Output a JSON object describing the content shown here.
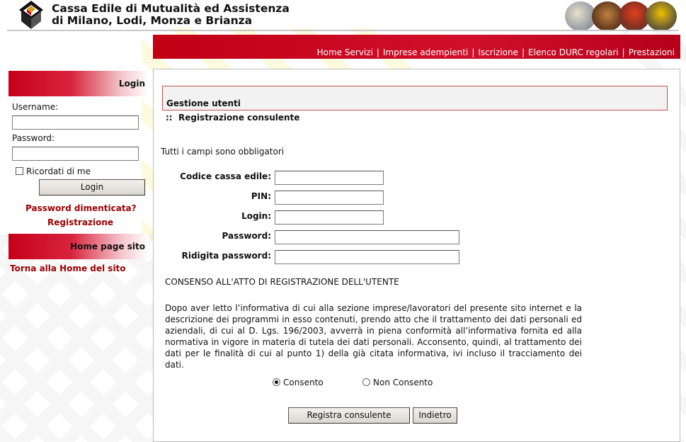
{
  "header": {
    "org_line1": "Cassa Edile di Mutualità ed Assistenza",
    "org_line2": "di Milano, Lodi, Monza e Brianza"
  },
  "nav": {
    "items": [
      "Home Servizi",
      "Imprese adempienti",
      "Iscrizione",
      "Elenco DURC regolari",
      "Prestazioni"
    ],
    "separator": "|"
  },
  "login_box": {
    "title": "Login",
    "username_label": "Username:",
    "username_value": "",
    "password_label": "Password:",
    "password_value": "",
    "remember_label": "Ricordati di me",
    "remember_checked": false,
    "login_button": "Login",
    "forgot_link": "Password dimenticata?",
    "register_link": "Registrazione"
  },
  "home_box": {
    "title": "Home page sito",
    "back_link": "Torna alla Home del sito"
  },
  "main": {
    "section_title": "Gestione utenti",
    "subtitle_prefix": "::",
    "subtitle": "Registrazione consulente",
    "required_note": "Tutti i campi sono obbligatori",
    "fields": [
      {
        "label": "Codice cassa edile:",
        "value": ""
      },
      {
        "label": "PIN:",
        "value": ""
      },
      {
        "label": "Login:",
        "value": ""
      },
      {
        "label": "Password:",
        "value": ""
      },
      {
        "label": "Ridigita password:",
        "value": ""
      }
    ],
    "consent_heading": "CONSENSO ALL'ATTO DI REGISTRAZIONE DELL'UTENTE",
    "consent_text": "Dopo aver letto l’informativa di cui alla sezione imprese/lavoratori del presente sito internet e la descrizione dei programmi in esso contenuti, prendo atto che il trattamento dei dati personali ed aziendali, di cui al D. Lgs. 196/2003, avverrà in piena conformità all’informativa fornita ed alla normativa in vigore in materia di tutela dei dati personali. Acconsento, quindi, al trattamento dei dati per le finalità di cui al punto 1) della già citata informativa, ivi incluso il tracciamento dei dati.",
    "consent_options": [
      {
        "label": "Consento",
        "selected": true
      },
      {
        "label": "Non Consento",
        "selected": false
      }
    ],
    "submit_button": "Registra consulente",
    "back_button": "Indietro"
  },
  "colors": {
    "brand_red": "#c8001a",
    "link_red": "#9b0000",
    "panel_border": "#c0504d"
  }
}
